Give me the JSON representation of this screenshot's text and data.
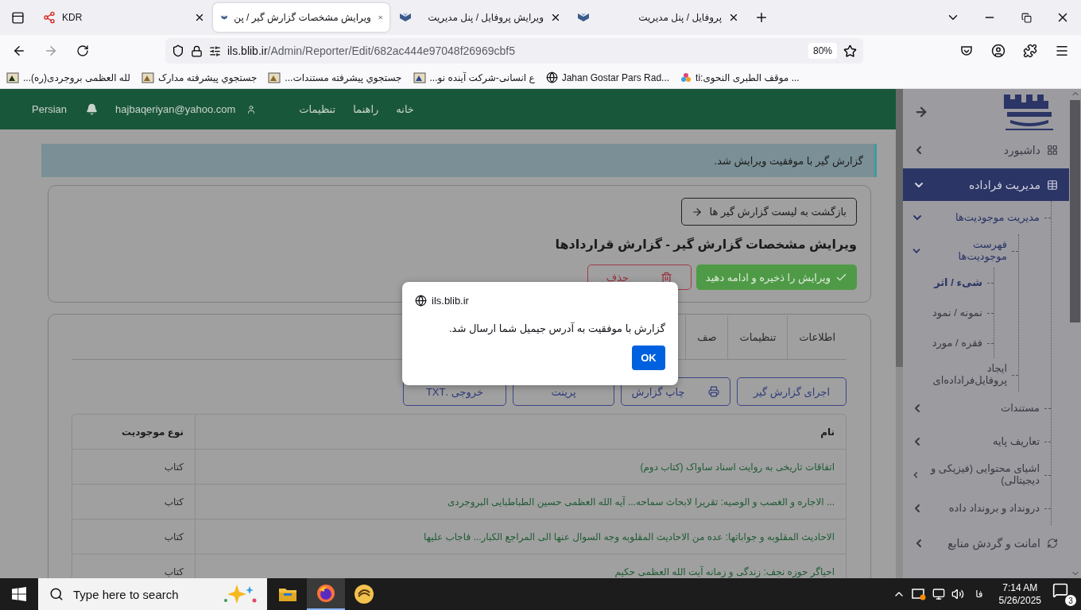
{
  "browser": {
    "tabs": [
      {
        "title": "پروفایل / پنل مدیریت",
        "selected": false
      },
      {
        "title": "ویرایش پروفایل / پنل مدیریت",
        "selected": false
      },
      {
        "title": "ویرایش مشخصات گزارش گیر / پن",
        "selected": true
      },
      {
        "title": "KDR",
        "selected": false
      }
    ],
    "address": {
      "host": "ils.blib.ir",
      "path": "/Admin/Reporter/Edit/682ac444e97048f26969cbf5"
    },
    "zoom": "80%",
    "bookmarks": [
      {
        "label": "ti:موقف الطبری النحوی ..."
      },
      {
        "label": "Jahan Gostar Pars Rad..."
      },
      {
        "label": "...ع انسانی-شرکت آینده نو"
      },
      {
        "label": "...جستجوي پيشرفته مستندات"
      },
      {
        "label": "جستجوي پيشرفته مدارک"
      },
      {
        "label": "...لله العظمی بروجردی(ره)"
      }
    ]
  },
  "header": {
    "links": [
      "خانه",
      "راهنما",
      "تنظیمات"
    ],
    "user": "hajbaqeriyan@yahoo.com",
    "language": "Persian"
  },
  "alert": "گزارش گیر با موفقیت ویرایش شد.",
  "back_button": "بازگشت به لیست گزارش گیر ها",
  "title": "ویرایش مشخصات گزارش گیر - گزارش قراردادها",
  "save_button": "ویرایش را ذخیره و ادامه دهید",
  "delete_button": "حذف",
  "tabs": [
    {
      "label": "اطلاعات",
      "selected": false
    },
    {
      "label": "تنظیمات",
      "selected": false
    },
    {
      "label": "صف",
      "selected": false
    }
  ],
  "actions": [
    "اجرای گزارش گیر",
    "چاپ گزارش",
    "پرینت",
    "خروجی .TXT"
  ],
  "table": {
    "columns": [
      "نام",
      "نوع موجودیت"
    ],
    "rows": [
      {
        "name": "اتفاقات تاریخی به روایت اسناد ساواک (کتاب دوم)",
        "type": "کتاب"
      },
      {
        "name": "... الاجاره و الغصب و الوصیه: تقریرا لابحاث سماحه... آیه الله العظمی حسین الطباطبایی البروجردی",
        "type": "کتاب"
      },
      {
        "name": "الاحادیث المقلوبه و جواباتها: عده من الاحادیث المقلوبه وجه السوال عنها الی المراجع الکبار... فاجاب علیها",
        "type": "کتاب"
      },
      {
        "name": "احیاگر حوزه نجف: زندگی و زمانه آیت الله العظمی حکیم",
        "type": "کتاب"
      }
    ]
  },
  "dialog": {
    "origin": "ils.blib.ir",
    "message": "گزارش با موفقیت به آدرس جیمیل شما ارسال شد.",
    "button": "OK"
  },
  "sidebar": {
    "items": [
      {
        "label": "داشبورد",
        "selected": false,
        "expanded": false
      },
      {
        "label": "مدیریت فراداده",
        "selected": true,
        "expanded": true,
        "children": [
          {
            "label": "مدیریت موجودیت‌ها",
            "selected": false,
            "expanded": true,
            "children": [
              {
                "label": "فهرست موجودیت‌ها",
                "selected": false,
                "expanded": true,
                "children": [
                  {
                    "label": "شیء / اثر",
                    "selected": true
                  },
                  {
                    "label": "نمونه / نمود",
                    "selected": false
                  },
                  {
                    "label": "فقره / مورد",
                    "selected": false
                  }
                ]
              },
              {
                "label": "ایجاد پروفایل‌فراداده‌ای",
                "selected": false
              }
            ]
          },
          {
            "label": "مستندات",
            "selected": false,
            "expanded": false
          },
          {
            "label": "تعاریف پایه",
            "selected": false,
            "expanded": false
          },
          {
            "label": "اشیای محتوایی (فیزیکی و دیجیتالی)",
            "selected": false,
            "expanded": false
          },
          {
            "label": "درونداد و برونداد داده",
            "selected": false,
            "expanded": false
          }
        ]
      },
      {
        "label": "امانت و گردش منابع",
        "selected": false,
        "expanded": false
      }
    ]
  },
  "taskbar": {
    "search_placeholder": "Type here to search",
    "language": "فا",
    "time": "7:14 AM",
    "date": "5/26/2025",
    "notifications": "3"
  }
}
